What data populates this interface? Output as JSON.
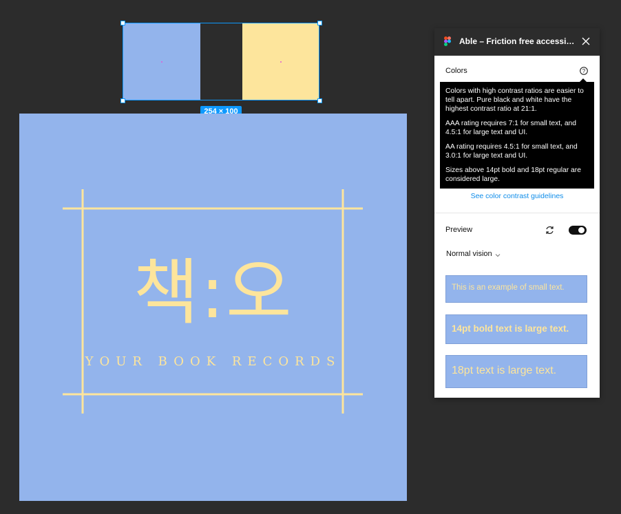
{
  "canvas": {
    "swatches": [
      {
        "name": "blue",
        "color": "#93b4ec"
      },
      {
        "name": "yellow",
        "color": "#fde59c"
      }
    ],
    "selection_size": "254 × 100",
    "artwork": {
      "title": "책:오",
      "subtitle": "YOUR BOOK RECORDS",
      "background": "#93b4ec",
      "foreground": "#fde59c"
    }
  },
  "panel": {
    "title": "Able – Friction free accessibility",
    "colors_label": "Colors",
    "tooltip": [
      "Colors with high contrast ratios are easier to tell apart. Pure black and white have the highest contrast ratio at 21:1.",
      "AAA rating requires 7:1 for small text, and 4.5:1 for large text and UI.",
      "AA rating requires 4.5:1 for small text, and 3.0:1 for large text and UI.",
      "Sizes above 14pt bold and 18pt regular are considered large."
    ],
    "guide_link": "See color contrast guidelines",
    "preview_label": "Preview",
    "preview_enabled": true,
    "vision_mode": "Normal vision",
    "samples": {
      "small": "This is an example of small text.",
      "bold": "14pt bold text is large text.",
      "large": "18pt text is large text."
    }
  }
}
